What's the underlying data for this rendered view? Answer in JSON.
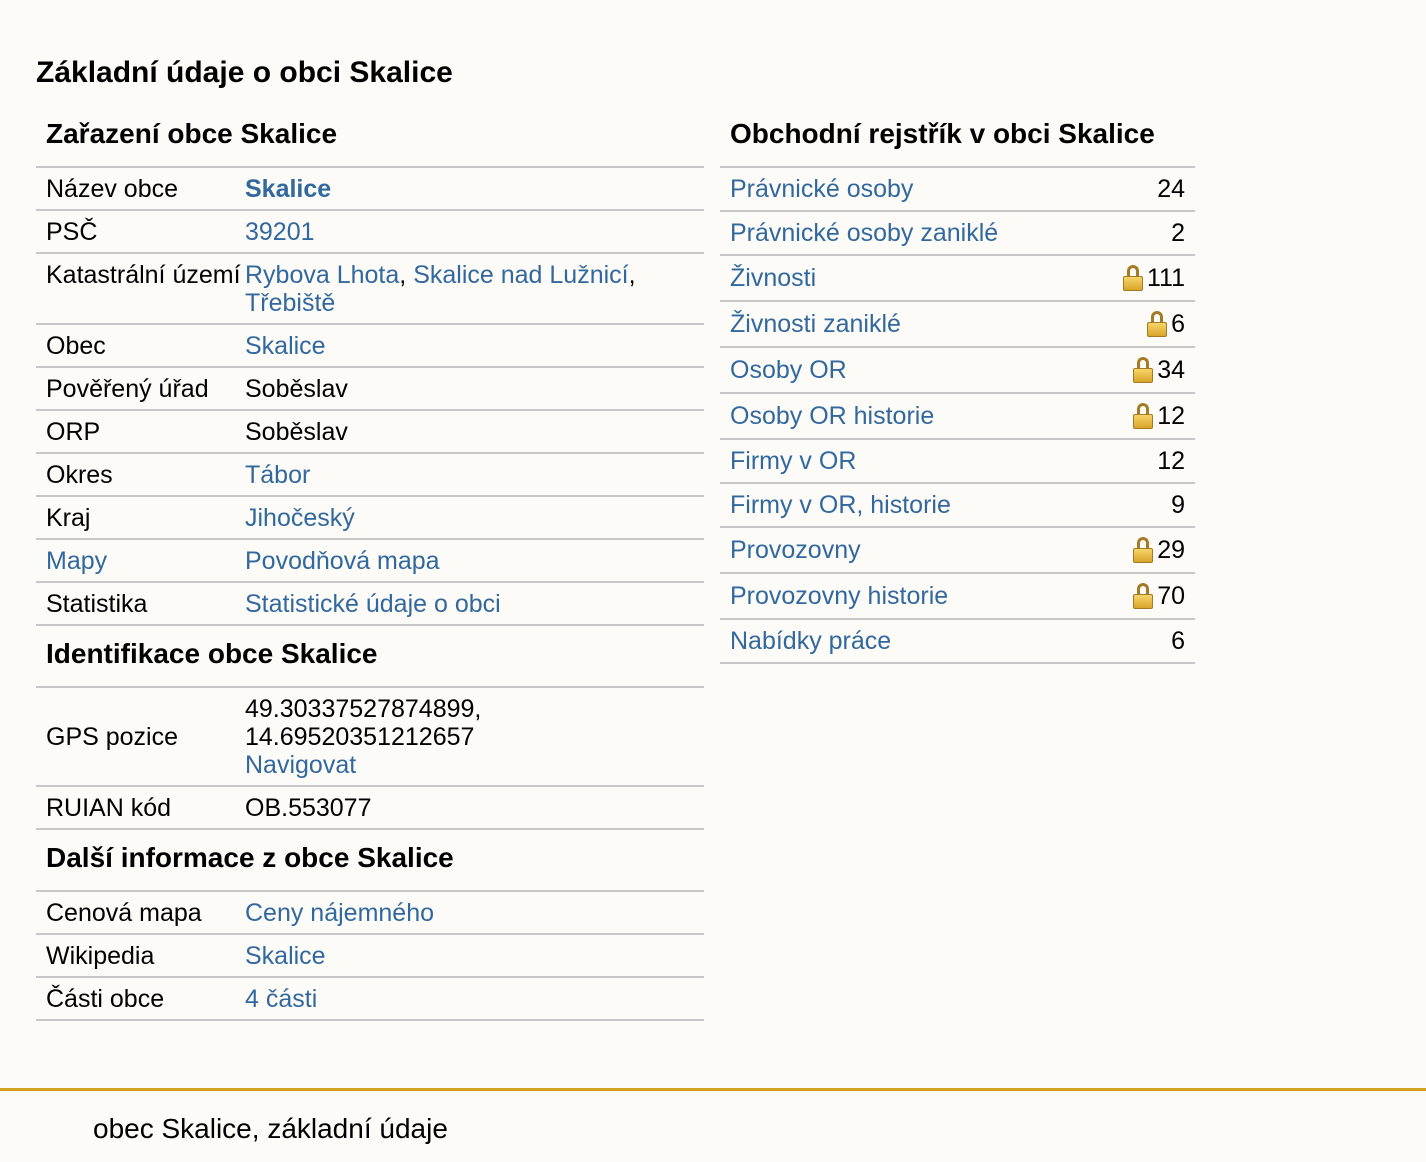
{
  "page_title": "Základní údaje o obci Skalice",
  "zarazeni": {
    "heading": "Zařazení obce Skalice",
    "rows": [
      {
        "label": "Název obce",
        "value": "Skalice"
      },
      {
        "label": "PSČ",
        "value": "39201"
      },
      {
        "label": "Katastrální území",
        "values": [
          "Rybova Lhota",
          "Skalice nad Lužnicí",
          "Třebiště"
        ]
      },
      {
        "label": "Obec",
        "value": "Skalice"
      },
      {
        "label": "Pověřený úřad",
        "value": "Soběslav"
      },
      {
        "label": "ORP",
        "value": "Soběslav"
      },
      {
        "label": "Okres",
        "value": "Tábor"
      },
      {
        "label": "Kraj",
        "value": "Jihočeský"
      },
      {
        "label": "Mapy",
        "value": "Povodňová mapa"
      },
      {
        "label": "Statistika",
        "value": "Statistické údaje o obci"
      }
    ]
  },
  "identifikace": {
    "heading": "Identifikace obce Skalice",
    "gps_label": "GPS pozice",
    "gps_lat": "49.30337527874899,",
    "gps_lon": "14.69520351212657",
    "gps_link": "Navigovat",
    "ruian_label": "RUIAN kód",
    "ruian_value": "OB.553077"
  },
  "dalsi": {
    "heading": "Další informace z obce Skalice",
    "rows": [
      {
        "label": "Cenová mapa",
        "value": "Ceny nájemného"
      },
      {
        "label": "Wikipedia",
        "value": "Skalice"
      },
      {
        "label": "Části obce",
        "value": "4 části"
      }
    ]
  },
  "rejstrik": {
    "heading": "Obchodní rejstřík v obci Skalice",
    "rows": [
      {
        "label": "Právnické osoby",
        "count": "24",
        "locked": false
      },
      {
        "label": "Právnické osoby zaniklé",
        "count": "2",
        "locked": false
      },
      {
        "label": "Živnosti",
        "count": "111",
        "locked": true
      },
      {
        "label": "Živnosti zaniklé",
        "count": "6",
        "locked": true
      },
      {
        "label": "Osoby OR",
        "count": "34",
        "locked": true
      },
      {
        "label": "Osoby OR historie",
        "count": "12",
        "locked": true
      },
      {
        "label": "Firmy v OR",
        "count": "12",
        "locked": false
      },
      {
        "label": "Firmy v OR, historie",
        "count": "9",
        "locked": false
      },
      {
        "label": "Provozovny",
        "count": "29",
        "locked": true
      },
      {
        "label": "Provozovny historie",
        "count": "70",
        "locked": true
      },
      {
        "label": "Nabídky práce",
        "count": "6",
        "locked": false
      }
    ]
  },
  "footer": {
    "text": "obec Skalice, základní údaje"
  },
  "colors": {
    "link": "#31689e",
    "footer_accent": "#d4a020",
    "border": "#c8c8c8",
    "background": "#fcfbf7"
  },
  "icons": {
    "lock": "lock-icon"
  }
}
